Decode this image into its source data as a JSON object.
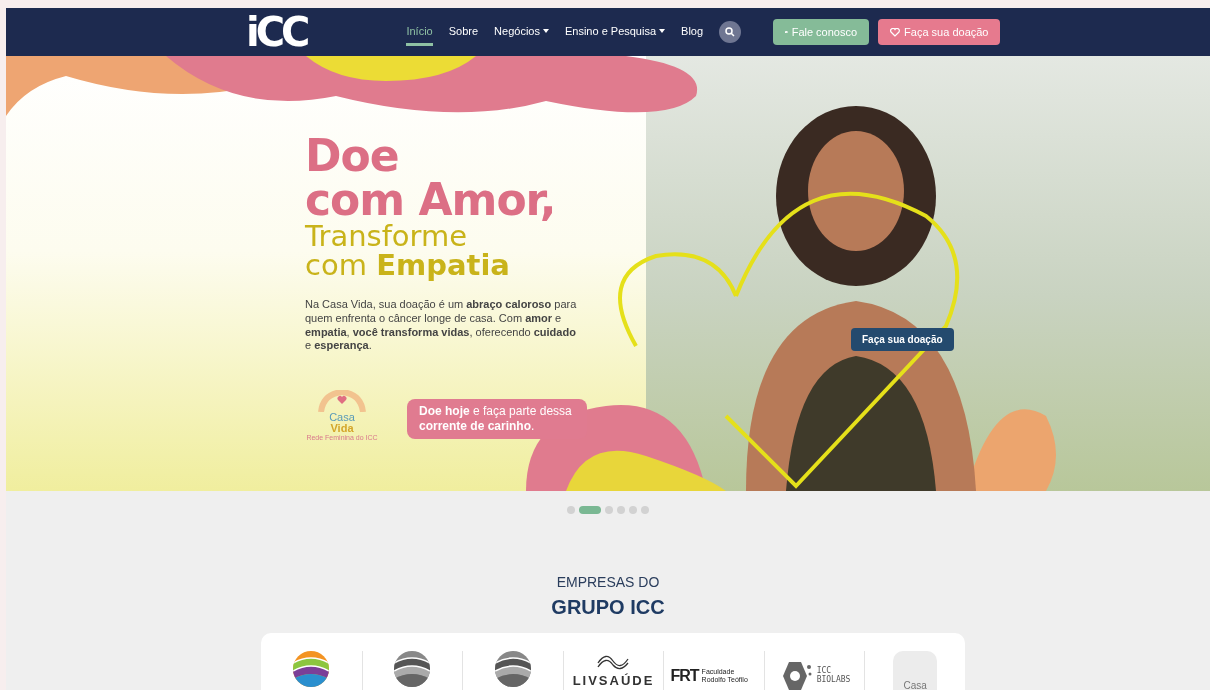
{
  "navbar": {
    "logo": "iCC",
    "links": [
      {
        "label": "Início",
        "selected": true,
        "dropdown": false
      },
      {
        "label": "Sobre",
        "selected": false,
        "dropdown": false
      },
      {
        "label": "Negócios",
        "selected": false,
        "dropdown": true
      },
      {
        "label": "Ensino e Pesquisa",
        "selected": false,
        "dropdown": true
      },
      {
        "label": "Blog",
        "selected": false,
        "dropdown": false
      }
    ],
    "contact_button": "Fale conosco",
    "donate_button": "Faça sua doação"
  },
  "hero": {
    "headline_lines": [
      {
        "text": "Doe",
        "kind": "strong"
      },
      {
        "text": "com Amor,",
        "kind": "strong"
      },
      {
        "text": "Transforme",
        "kind": "light"
      },
      {
        "text": "com **Empatia**",
        "kind": "light"
      }
    ],
    "paragraph": "Na Casa Vida, sua doação é um **abraço caloroso** para quem enfrenta o câncer longe de casa. Com **amor** e **empatia**, **você transforma vidas**, oferecendo **cuidado** e **esperança**.",
    "casa_vida_logo": {
      "line1": "Casa",
      "line2": "Vida",
      "tagline": "Rede Feminina do ICC"
    },
    "cta": "**Doe hoje** e faça parte dessa **corrente de carinho**.",
    "photo_button": "Faça sua doação"
  },
  "carousel_dots": [
    {
      "selected": false
    },
    {
      "selected": true
    },
    {
      "selected": false
    },
    {
      "selected": false
    },
    {
      "selected": false
    },
    {
      "selected": false
    }
  ],
  "companies": {
    "subtitle": "EMPRESAS DO",
    "title": "GRUPO ICC",
    "logos": [
      {
        "kind": "sphere-color"
      },
      {
        "kind": "sphere-gray"
      },
      {
        "kind": "sphere-gray"
      },
      {
        "kind": "livsaude",
        "text": "LIVSAÚDE"
      },
      {
        "kind": "frt",
        "text": "FRT",
        "caption": "Faculdade Rodolfo Teófilo"
      },
      {
        "kind": "biolabs",
        "text": "ICC BIOLABS"
      },
      {
        "kind": "casa",
        "text": "Casa"
      }
    ]
  }
}
